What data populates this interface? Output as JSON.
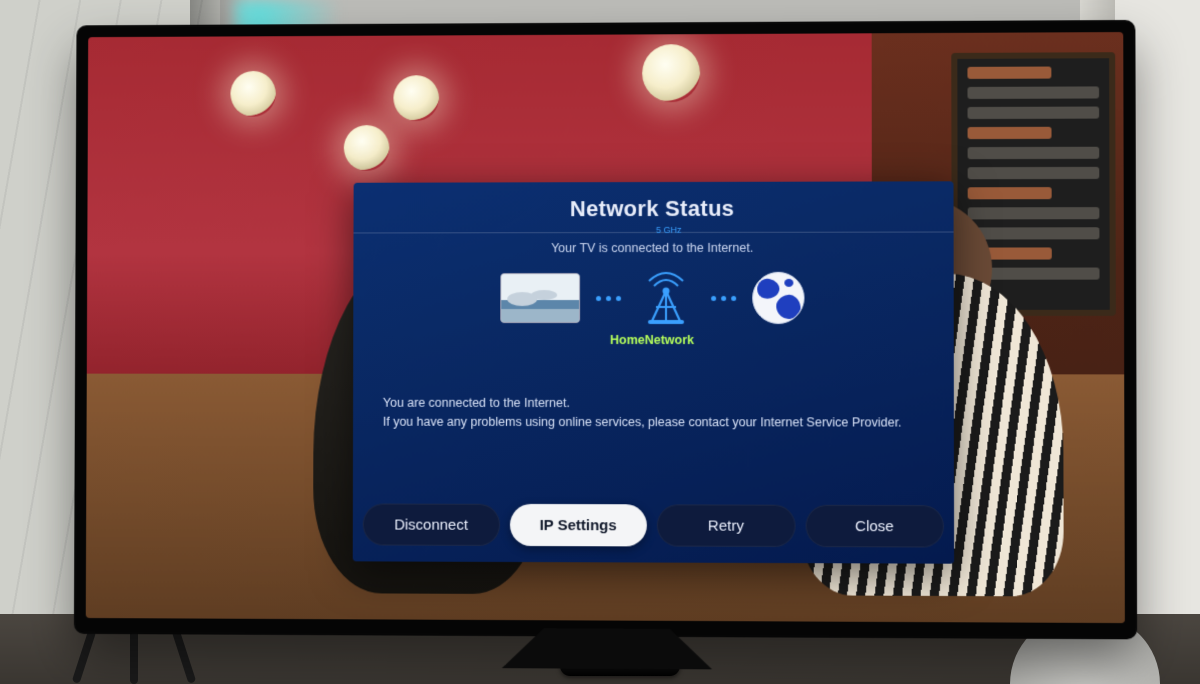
{
  "dialog": {
    "title": "Network Status",
    "subtitle": "Your TV is connected to the Internet.",
    "router_band": "5 GHz",
    "network_name": "HomeNetwork",
    "message_line1": "You are connected to the Internet.",
    "message_line2": "If you have any problems using online services, please contact your Internet Service Provider.",
    "buttons": {
      "disconnect": "Disconnect",
      "ip_settings": "IP Settings",
      "retry": "Retry",
      "close": "Close"
    },
    "selected_button": "ip_settings"
  },
  "icons": {
    "tv": "tv-device-icon",
    "router": "wifi-router-icon",
    "globe": "internet-globe-icon"
  },
  "colors": {
    "dialog_bg_top": "#0b2f72",
    "dialog_bg_bottom": "#041a4e",
    "accent": "#3aa0ff",
    "network_name": "#b6ff5b",
    "button_bg": "#0e1b3d",
    "button_selected_bg": "#f4f5f7",
    "button_selected_fg": "#10182a"
  }
}
